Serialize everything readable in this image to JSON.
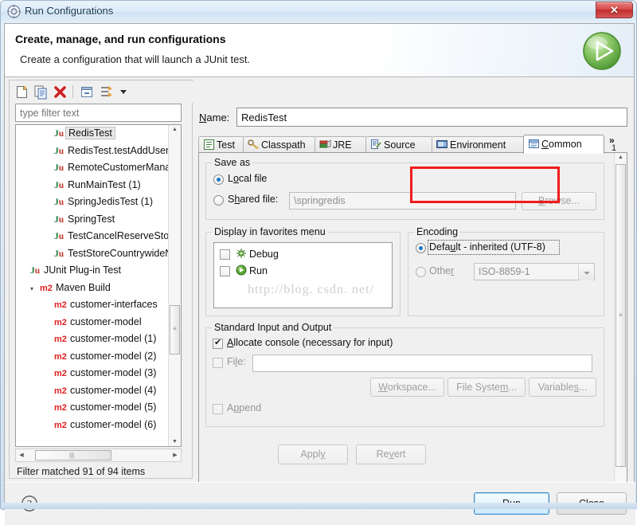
{
  "window": {
    "title": "Run Configurations",
    "title_icon": "run-configurations-icon",
    "close_glyph": "✕"
  },
  "header": {
    "title": "Create, manage, and run configurations",
    "description": "Create a configuration that will launch a JUnit test.",
    "banner_icon": "run-green-play-icon"
  },
  "left_panel": {
    "toolbar": [
      {
        "name": "new-configuration-icon",
        "tip": "New launch configuration"
      },
      {
        "name": "duplicate-configuration-icon",
        "tip": "Duplicate"
      },
      {
        "name": "delete-configuration-icon",
        "tip": "Delete"
      },
      {
        "name": "collapse-all-icon",
        "tip": "Collapse All"
      },
      {
        "name": "filter-icon",
        "tip": "Filter"
      },
      {
        "name": "chevron-down-icon",
        "tip": "Menu"
      }
    ],
    "filter": {
      "placeholder": "type filter text",
      "value": ""
    },
    "tree": [
      {
        "label": "RedisTest",
        "icon": "junit-icon",
        "indent": 1,
        "selected": true
      },
      {
        "label": "RedisTest.testAddUser",
        "icon": "junit-icon",
        "indent": 1,
        "selected": false
      },
      {
        "label": "RemoteCustomerMana",
        "icon": "junit-icon",
        "indent": 1,
        "selected": false
      },
      {
        "label": "RunMainTest (1)",
        "icon": "junit-icon",
        "indent": 1,
        "selected": false
      },
      {
        "label": "SpringJedisTest (1)",
        "icon": "junit-icon",
        "indent": 1,
        "selected": false
      },
      {
        "label": "SpringTest",
        "icon": "junit-icon",
        "indent": 1,
        "selected": false
      },
      {
        "label": "TestCancelReserveStoc",
        "icon": "junit-icon",
        "indent": 1,
        "selected": false
      },
      {
        "label": "TestStoreCountrywideN",
        "icon": "junit-icon",
        "indent": 1,
        "selected": false
      },
      {
        "label": "JUnit Plug-in Test",
        "icon": "junit-plugin-icon",
        "indent": 0,
        "selected": false
      },
      {
        "label": "Maven Build",
        "icon": "maven-icon",
        "indent": 0,
        "selected": false,
        "expanded": true
      },
      {
        "label": "customer-interfaces",
        "icon": "maven-icon",
        "indent": 1,
        "selected": false
      },
      {
        "label": "customer-model",
        "icon": "maven-icon",
        "indent": 1,
        "selected": false
      },
      {
        "label": "customer-model (1)",
        "icon": "maven-icon",
        "indent": 1,
        "selected": false
      },
      {
        "label": "customer-model (2)",
        "icon": "maven-icon",
        "indent": 1,
        "selected": false
      },
      {
        "label": "customer-model (3)",
        "icon": "maven-icon",
        "indent": 1,
        "selected": false
      },
      {
        "label": "customer-model (4)",
        "icon": "maven-icon",
        "indent": 1,
        "selected": false
      },
      {
        "label": "customer-model (5)",
        "icon": "maven-icon",
        "indent": 1,
        "selected": false
      },
      {
        "label": "customer-model (6)",
        "icon": "maven-icon",
        "indent": 1,
        "selected": false
      }
    ],
    "status": "Filter matched 91 of 94 items"
  },
  "right_panel": {
    "name_label": "Name:",
    "name_label_mnemonic": "N",
    "name_value": "RedisTest",
    "tabs": [
      {
        "label": "Test",
        "icon": "test-icon",
        "active": false
      },
      {
        "label": "Classpath",
        "icon": "classpath-icon",
        "active": false
      },
      {
        "label": "JRE",
        "icon": "jre-icon",
        "active": false
      },
      {
        "label": "Source",
        "icon": "source-icon",
        "active": false
      },
      {
        "label": "Environment",
        "icon": "environment-icon",
        "active": false
      },
      {
        "label": "Common",
        "icon": "common-icon",
        "active": true
      }
    ],
    "tab_overflow": {
      "chevron": "»",
      "count": "1"
    },
    "save_as": {
      "group_title": "Save as",
      "local_file": {
        "label": "Local file",
        "mnemonic": "o",
        "checked": true
      },
      "shared_file": {
        "label": "Shared file:",
        "mnemonic": "h",
        "checked": false
      },
      "shared_path_value": "\\springredis",
      "browse_button": "Browse...",
      "browse_mnemonic": "B"
    },
    "favorites": {
      "group_title": "Display in favorites menu",
      "items": [
        {
          "label": "Debug",
          "icon": "debug-bug-icon",
          "checked": false
        },
        {
          "label": "Run",
          "icon": "run-play-icon",
          "checked": false
        }
      ]
    },
    "encoding": {
      "group_title": "Encoding",
      "default_option": {
        "label": "Default - inherited (UTF-8)",
        "mnemonic": "u",
        "checked": true,
        "focused": true
      },
      "other_option": {
        "label": "Other",
        "mnemonic": "r",
        "checked": false
      },
      "other_value": "ISO-8859-1",
      "highlighted": true,
      "highlight_color": "#f21b1b"
    },
    "std_io": {
      "group_title": "Standard Input and Output",
      "allocate_console": {
        "label": "Allocate console (necessary for input)",
        "mnemonic": "A",
        "checked": true
      },
      "file": {
        "label": "File:",
        "mnemonic": "l",
        "checked": false,
        "value": ""
      },
      "workspace_button": "Workspace...",
      "filesystem_button": "File System...",
      "variables_button": "Variables...",
      "append": {
        "label": "Append",
        "mnemonic": "p",
        "checked": false,
        "disabled": true
      }
    },
    "apply_button": {
      "label": "Apply",
      "mnemonic": "y",
      "disabled": true
    },
    "revert_button": {
      "label": "Revert",
      "mnemonic": "v",
      "disabled": true
    }
  },
  "footer": {
    "help_icon": "help-question-icon",
    "run_button": {
      "label": "Run",
      "mnemonic": "R",
      "default": true
    },
    "close_button": {
      "label": "Close"
    }
  },
  "watermark": "http://blog. csdn. net/"
}
